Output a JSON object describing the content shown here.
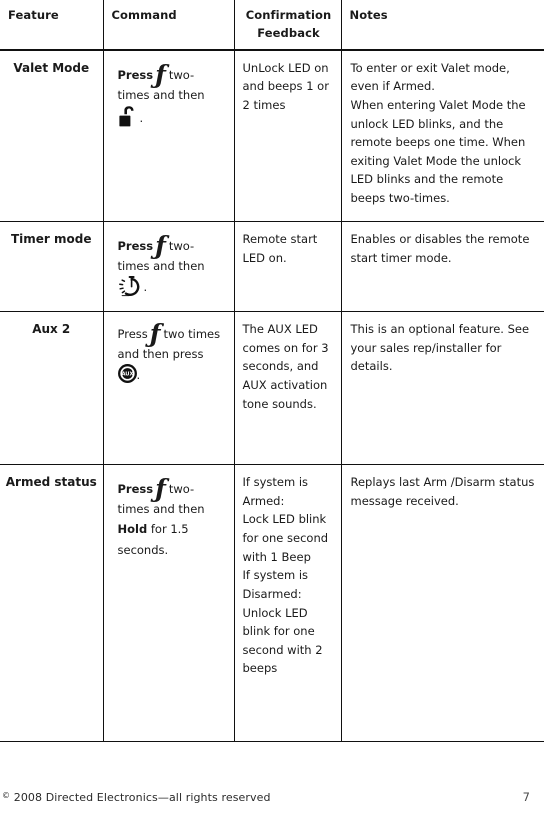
{
  "table": {
    "columns": [
      {
        "label": "Feature",
        "align": "left"
      },
      {
        "label": "Command",
        "align": "left"
      },
      {
        "label": "Confirmation Feedback",
        "label_line1": "Confirmation",
        "label_line2": "Feedback",
        "align": "center"
      },
      {
        "label": "Notes",
        "align": "left"
      }
    ],
    "rows": [
      {
        "feature": "Valet Mode",
        "command": {
          "press_label": "Press",
          "press_bold": true,
          "icon_primary": "f-function-glyph",
          "text_after": "two-times and then",
          "icon_secondary": "unlock-padlock-icon",
          "trailing": "."
        },
        "confirmation": "UnLock LED on and beeps 1 or 2 times",
        "notes": "To enter or exit Valet mode, even if Armed.\nWhen entering Valet Mode the unlock LED blinks, and the remote beeps one time. When exiting Valet Mode the unlock LED blinks and the remote beeps two-times."
      },
      {
        "feature": "Timer mode",
        "command": {
          "press_label": "Press",
          "press_bold": true,
          "icon_primary": "f-function-glyph",
          "text_after": "two-times and then",
          "icon_secondary": "stopwatch-timer-icon",
          "trailing": "."
        },
        "confirmation": "Remote start LED on.",
        "notes": "Enables or disables the remote start timer mode."
      },
      {
        "feature": "Aux 2",
        "command": {
          "press_label": "Press",
          "press_bold": false,
          "icon_primary": "f-function-glyph",
          "text_after": "two times and then press",
          "icon_secondary": "aux-button-icon",
          "trailing": "."
        },
        "confirmation": "The AUX LED comes on for 3 seconds, and AUX activation tone sounds.",
        "notes": "This is an optional feature. See your sales rep/installer for details."
      },
      {
        "feature": "Armed status",
        "command": {
          "press_label": "Press",
          "press_bold": true,
          "icon_primary": "f-function-glyph",
          "text_after": "two-times and then",
          "hold_label": "Hold",
          "hold_suffix": "for 1.5 seconds.",
          "icon_secondary": null,
          "trailing": ""
        },
        "confirmation": "If system is Armed:\nLock LED blink for one second with 1 Beep\nIf system is Disarmed:\nUnlock LED blink for one second with 2 beeps",
        "notes": "Replays last Arm /Disarm status message received."
      }
    ]
  },
  "footer": {
    "copyright_symbol": "©",
    "copyright": "2008 Directed Electronics—all rights reserved",
    "page_number": "7"
  },
  "colors": {
    "rule": "#111111",
    "text": "#1a1a1a",
    "footer_text": "#2a2a2a",
    "page_number": "#4a4a4a",
    "background": "#ffffff"
  },
  "icon_labels": {
    "aux_button_text": "AUX"
  }
}
